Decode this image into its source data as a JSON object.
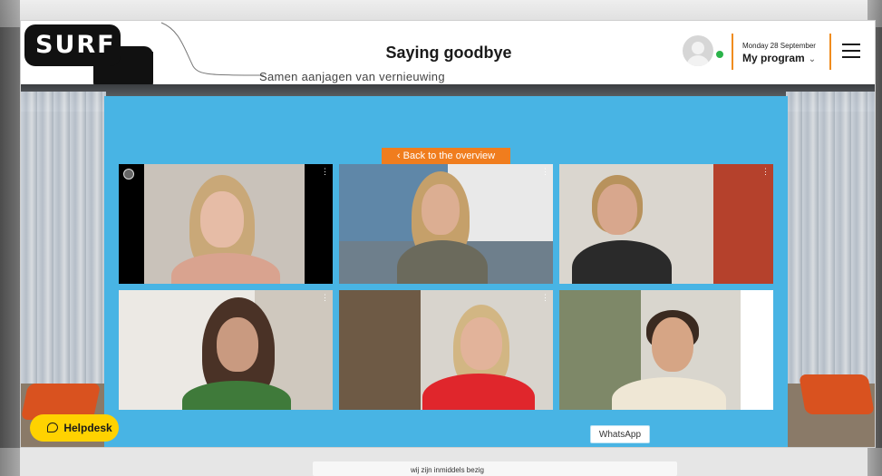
{
  "header": {
    "logo_text": "SURF",
    "tagline": "Samen aanjagen van vernieuwing",
    "title": "Saying goodbye",
    "date": "Monday 28 September",
    "program_label": "My program",
    "program_chevron": "⌄"
  },
  "stage": {
    "back_label": "‹ Back to the overview",
    "tiles": [
      {
        "name": "participant-1"
      },
      {
        "name": "participant-2"
      },
      {
        "name": "participant-3"
      },
      {
        "name": "participant-4"
      },
      {
        "name": "participant-5"
      },
      {
        "name": "participant-6"
      }
    ],
    "tile_menu": "⋮"
  },
  "widgets": {
    "helpdesk_label": "Helpdesk",
    "whatsapp_label": "WhatsApp"
  },
  "footer": {
    "status_text": "wij zijn inmiddels bezig"
  },
  "colors": {
    "accent_orange": "#f07d1e",
    "panel_blue": "#48b4e4",
    "helpdesk_yellow": "#ffd200",
    "online_green": "#2bb34a"
  },
  "icons": [
    "user-avatar-icon",
    "online-status-icon",
    "hamburger-menu-icon",
    "chevron-down-icon",
    "chat-bubble-icon",
    "signal-icon",
    "more-options-icon"
  ]
}
